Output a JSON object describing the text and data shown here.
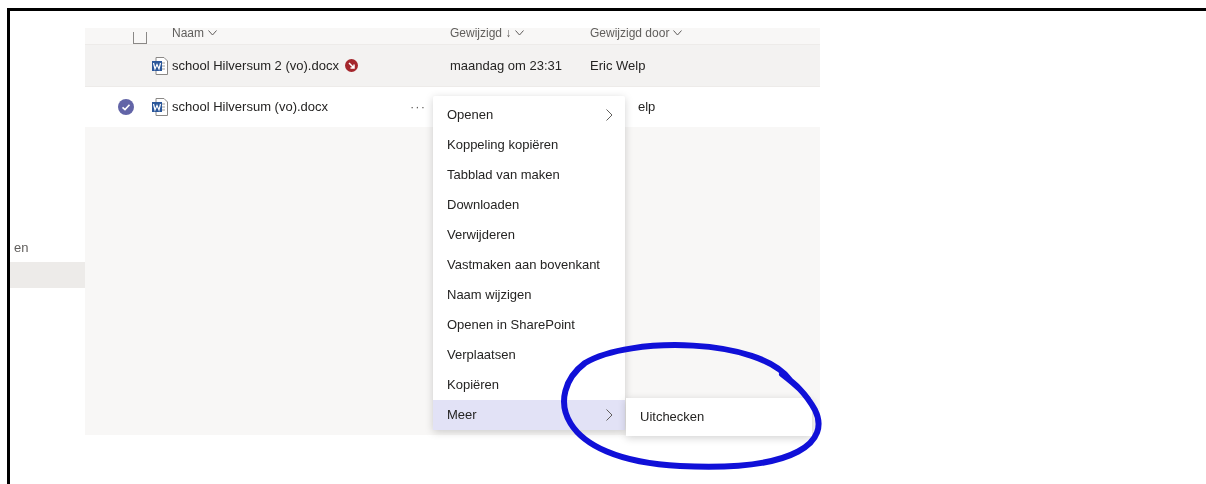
{
  "sidebar": {
    "items": [
      {
        "label": "en",
        "selected": false
      },
      {
        "selected": true
      }
    ]
  },
  "table": {
    "select_all": {
      "checked": false
    },
    "columns": [
      {
        "label": "Naam"
      },
      {
        "label": "Gewijzigd ↓"
      },
      {
        "label": "Gewijzigd door"
      }
    ],
    "rows": [
      {
        "name": "school Hilversum 2 (vo).docx",
        "checked_out": true,
        "selected": false,
        "modified": "maandag om 23:31",
        "modified_by": "Eric Welp"
      },
      {
        "name": "school Hilversum (vo).docx",
        "checked_out": false,
        "selected": true,
        "more": "···",
        "modified_by": "elp"
      }
    ]
  },
  "context_menu": {
    "items": [
      {
        "label": "Openen",
        "has_submenu": true,
        "selected": false
      },
      {
        "label": "Koppeling kopiëren",
        "has_submenu": false,
        "selected": false
      },
      {
        "label": "Tabblad van maken",
        "has_submenu": false,
        "selected": false
      },
      {
        "label": "Downloaden",
        "has_submenu": false,
        "selected": false
      },
      {
        "label": "Verwijderen",
        "has_submenu": false,
        "selected": false
      },
      {
        "label": "Vastmaken aan bovenkant",
        "has_submenu": false,
        "selected": false
      },
      {
        "label": "Naam wijzigen",
        "has_submenu": false,
        "selected": false
      },
      {
        "label": "Openen in SharePoint",
        "has_submenu": false,
        "selected": false
      },
      {
        "label": "Verplaatsen",
        "has_submenu": false,
        "selected": false
      },
      {
        "label": "Kopiëren",
        "has_submenu": false,
        "selected": false
      },
      {
        "label": "Meer",
        "has_submenu": true,
        "selected": true
      }
    ],
    "submenu": {
      "items": [
        {
          "label": "Uitchecken"
        }
      ]
    }
  }
}
